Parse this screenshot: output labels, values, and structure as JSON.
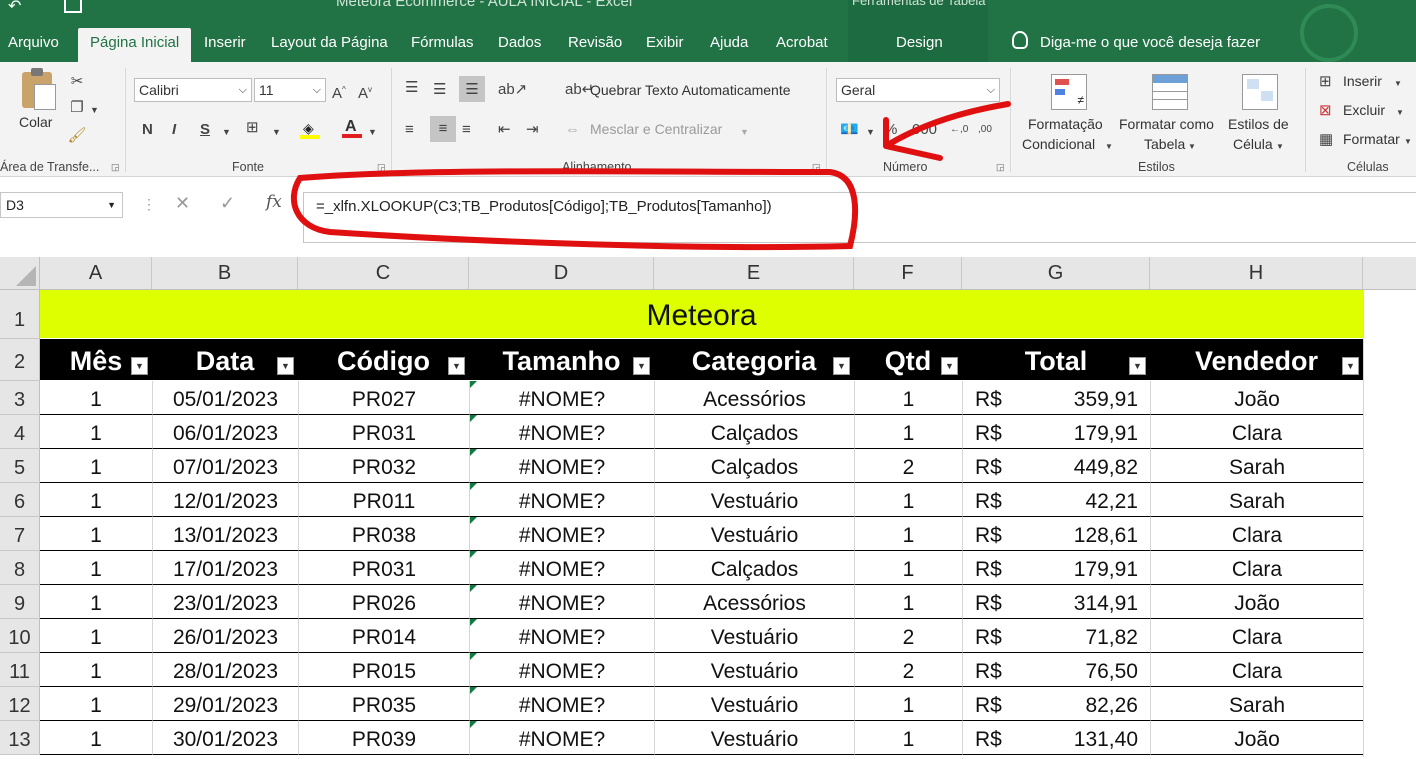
{
  "window": {
    "title": "Meteora Ecommerce - AULA INICIAL - Excel",
    "context_group": "Ferramentas de Tabela"
  },
  "tabs": [
    "Arquivo",
    "Página Inicial",
    "Inserir",
    "Layout da Página",
    "Fórmulas",
    "Dados",
    "Revisão",
    "Exibir",
    "Ajuda",
    "Acrobat",
    "Design"
  ],
  "active_tab": "Página Inicial",
  "tell_me": "Diga-me o que você deseja fazer",
  "ribbon": {
    "clipboard": {
      "paste_label": "Colar",
      "group_label": "Área de Transfe..."
    },
    "font": {
      "name": "Calibri",
      "size": "11",
      "bold": "N",
      "italic": "I",
      "underline": "S",
      "group_label": "Fonte"
    },
    "alignment": {
      "wrap_text": "Quebrar Texto Automaticamente",
      "merge_center": "Mesclar e Centralizar",
      "group_label": "Alinhamento"
    },
    "number": {
      "format": "Geral",
      "group_label": "Número"
    },
    "styles": {
      "conditional": [
        "Formatação",
        "Condicional"
      ],
      "as_table": [
        "Formatar como",
        "Tabela"
      ],
      "cell_styles": [
        "Estilos de",
        "Célula"
      ],
      "group_label": "Estilos"
    },
    "cells": {
      "insert": "Inserir",
      "delete": "Excluir",
      "format": "Formatar",
      "group_label": "Células"
    }
  },
  "formula_bar": {
    "name_box": "D3",
    "fx": "fx",
    "formula": "=_xlfn.XLOOKUP(C3;TB_Produtos[Código];TB_Produtos[Tamanho])"
  },
  "sheet": {
    "columns": [
      "A",
      "B",
      "C",
      "D",
      "E",
      "F",
      "G",
      "H"
    ],
    "rows": [
      "1",
      "2",
      "3",
      "4",
      "5",
      "6",
      "7",
      "8",
      "9",
      "10",
      "11",
      "12",
      "13"
    ],
    "banner": "Meteora",
    "headers": [
      "Mês",
      "Data",
      "Código",
      "Tamanho",
      "Categoria",
      "Qtd",
      "Total",
      "Vendedor"
    ],
    "currency": "R$",
    "data": [
      [
        "1",
        "05/01/2023",
        "PR027",
        "#NOME?",
        "Acessórios",
        "1",
        "359,91",
        "João"
      ],
      [
        "1",
        "06/01/2023",
        "PR031",
        "#NOME?",
        "Calçados",
        "1",
        "179,91",
        "Clara"
      ],
      [
        "1",
        "07/01/2023",
        "PR032",
        "#NOME?",
        "Calçados",
        "2",
        "449,82",
        "Sarah"
      ],
      [
        "1",
        "12/01/2023",
        "PR011",
        "#NOME?",
        "Vestuário",
        "1",
        "42,21",
        "Sarah"
      ],
      [
        "1",
        "13/01/2023",
        "PR038",
        "#NOME?",
        "Vestuário",
        "1",
        "128,61",
        "Clara"
      ],
      [
        "1",
        "17/01/2023",
        "PR031",
        "#NOME?",
        "Calçados",
        "1",
        "179,91",
        "Clara"
      ],
      [
        "1",
        "23/01/2023",
        "PR026",
        "#NOME?",
        "Acessórios",
        "1",
        "314,91",
        "João"
      ],
      [
        "1",
        "26/01/2023",
        "PR014",
        "#NOME?",
        "Vestuário",
        "2",
        "71,82",
        "Clara"
      ],
      [
        "1",
        "28/01/2023",
        "PR015",
        "#NOME?",
        "Vestuário",
        "2",
        "76,50",
        "Clara"
      ],
      [
        "1",
        "29/01/2023",
        "PR035",
        "#NOME?",
        "Vestuário",
        "1",
        "82,26",
        "Sarah"
      ],
      [
        "1",
        "30/01/2023",
        "PR039",
        "#NOME?",
        "Vestuário",
        "1",
        "131,40",
        "João"
      ]
    ]
  },
  "colors": {
    "excel_green": "#217346",
    "banner": "#ddff00",
    "header_bg": "#000000",
    "annotation": "#e01010"
  }
}
